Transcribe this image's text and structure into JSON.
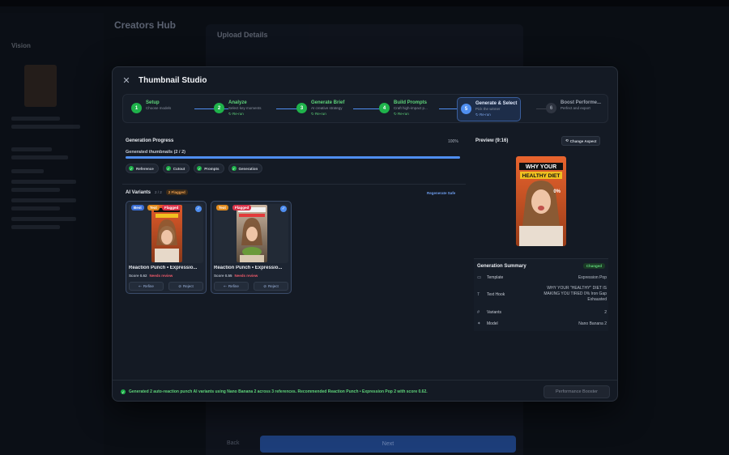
{
  "background": {
    "title": "Creators Hub",
    "panel_title": "Upload Details",
    "back_label": "Back",
    "next_label": "Next",
    "sidebar_user": "Vision"
  },
  "modal": {
    "title": "Thumbnail Studio",
    "steps": [
      {
        "num": "1",
        "label": "Setup",
        "sub": "Choose models",
        "rerun": ""
      },
      {
        "num": "2",
        "label": "Analyze",
        "sub": "Select key moments",
        "rerun": "Re-run"
      },
      {
        "num": "3",
        "label": "Generate Brief",
        "sub": "AI creative strategy",
        "rerun": "Re-run"
      },
      {
        "num": "4",
        "label": "Build Prompts",
        "sub": "Craft high-impact p...",
        "rerun": "Re-run"
      },
      {
        "num": "5",
        "label": "Generate & Select",
        "sub": "Pick the winner",
        "rerun": "Re-run"
      },
      {
        "num": "6",
        "label": "Boost Performe...",
        "sub": "Perfect and export",
        "rerun": ""
      }
    ],
    "generation": {
      "title": "Generation Progress",
      "percent": "100%",
      "label": "Generated thumbnails (2 / 2)",
      "progress_fraction": 1.0,
      "chips": [
        "Reference",
        "Cutout",
        "Prompts",
        "Generation"
      ]
    },
    "variants": {
      "title": "AI Variants",
      "count": "2 / 2",
      "flagged_badge": "2 Flagged",
      "regenerate": "Regenerate Safe",
      "items": [
        {
          "tags": [
            "Best",
            "Text",
            "Flagged"
          ],
          "name": "Reaction Punch • Expressio...",
          "score": "Score 0.62",
          "review": "Needs review",
          "refine": "Refine",
          "reject": "Reject"
        },
        {
          "tags": [
            "Text",
            "Flagged"
          ],
          "name": "Reaction Punch • Expressio...",
          "score": "Score 0.55",
          "review": "Needs review",
          "refine": "Refine",
          "reject": "Reject"
        }
      ]
    },
    "preview": {
      "title": "Preview (9:16)",
      "change_aspect": "Change Aspect",
      "overlay_text": "WHY YOUR HEALTHY DIET"
    },
    "summary": {
      "title": "Generation Summary",
      "status": "Changed",
      "rows": [
        {
          "icon": "template-icon",
          "key": "Template",
          "value": "Expression Pop"
        },
        {
          "icon": "text-hook-icon",
          "key": "Text Hook",
          "value": "WHY YOUR \"HEALTHY\" DIET IS MAKING YOU TIRED 0% Iron Gap Exhausted"
        },
        {
          "icon": "hash-icon",
          "key": "Variants",
          "value": "2"
        },
        {
          "icon": "model-icon",
          "key": "Model",
          "value": "Nano Banana 2"
        }
      ]
    },
    "footer": {
      "note": "Generated 2 auto-reaction punch AI variants using Nano Banana 2 across 3 references. Recommended Reaction Punch • Expression Pop 2 with score 0.62.",
      "performance_button": "Performance Booster"
    }
  }
}
